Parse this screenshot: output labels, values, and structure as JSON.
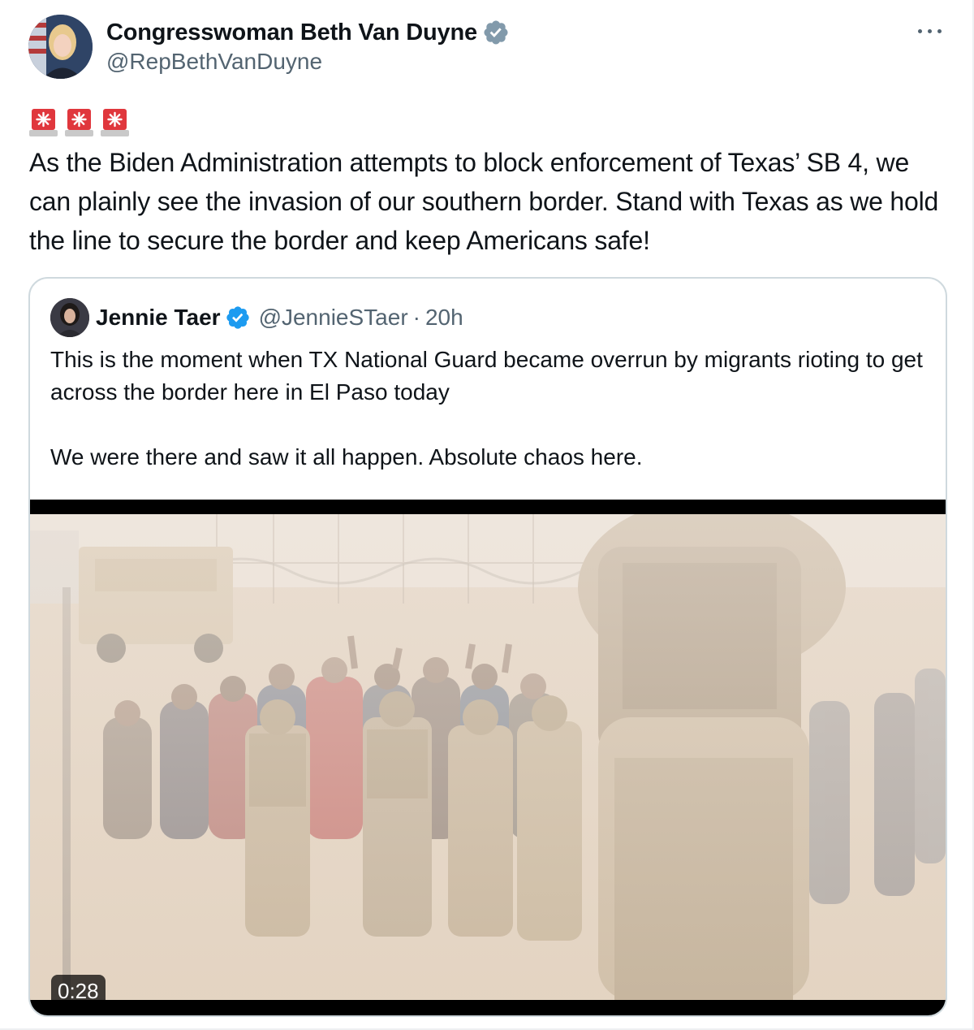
{
  "tweet": {
    "author_name": "Congresswoman Beth Van Duyne",
    "author_handle": "@RepBethVanDuyne",
    "more_icon": "more-horizontal-icon",
    "emoji": [
      "🚨",
      "🚨",
      "🚨"
    ],
    "text": "As the Biden Administration attempts to block enforcement of Texas’ SB 4, we can plainly see the invasion of our southern border. Stand with Texas as we hold the line to secure the border and keep Americans safe!"
  },
  "quote": {
    "author_name": "Jennie Taer",
    "author_handle": "@JennieSTaer",
    "separator": "·",
    "time": "20h",
    "text_line1": "This is the moment when TX National Guard became overrun by migrants rioting to get across the border here in El Paso today",
    "text_line2": "We were there and saw it all happen. Absolute chaos here.",
    "video_duration": "0:28"
  },
  "colors": {
    "verified_blue": "#1d9bf0",
    "gov_verified_gray": "#829aab",
    "text_primary": "#0f1419",
    "text_secondary": "#536471",
    "border": "#cfd9de",
    "siren_red": "#e0373d"
  }
}
